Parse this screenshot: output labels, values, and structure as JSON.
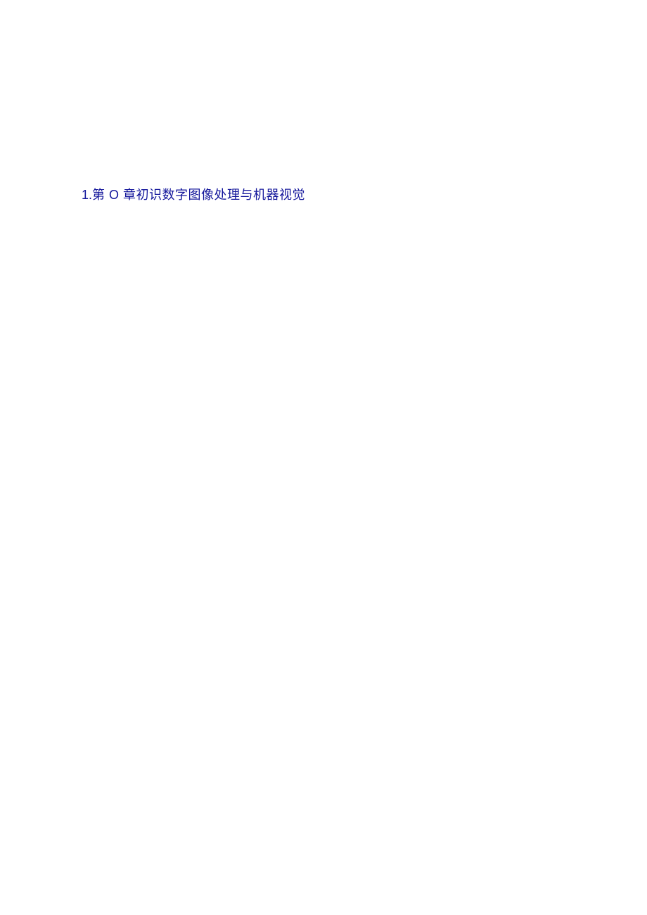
{
  "document": {
    "heading": {
      "number": "1.",
      "text": "第 O 章初识数字图像处理与机器视觉"
    }
  }
}
